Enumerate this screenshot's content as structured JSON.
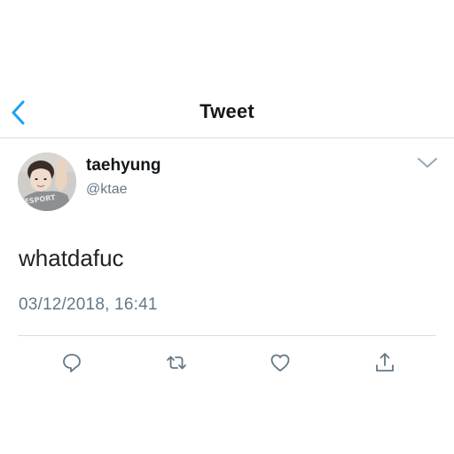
{
  "nav": {
    "title": "Tweet",
    "back_icon": "chevron-left-icon"
  },
  "tweet": {
    "author": {
      "display_name": "taehyung",
      "handle": "@ktae",
      "avatar_caption": "ESPORT"
    },
    "text": "whatdafuc",
    "timestamp": "03/12/2018, 16:41",
    "menu_icon": "chevron-down-icon"
  },
  "actions": [
    {
      "name": "reply",
      "icon": "reply-icon"
    },
    {
      "name": "retweet",
      "icon": "retweet-icon"
    },
    {
      "name": "like",
      "icon": "heart-icon"
    },
    {
      "name": "share",
      "icon": "share-icon"
    }
  ],
  "colors": {
    "accent": "#1da1f2",
    "text": "#14171a",
    "secondary": "#657786",
    "divider": "#d9dde1"
  }
}
